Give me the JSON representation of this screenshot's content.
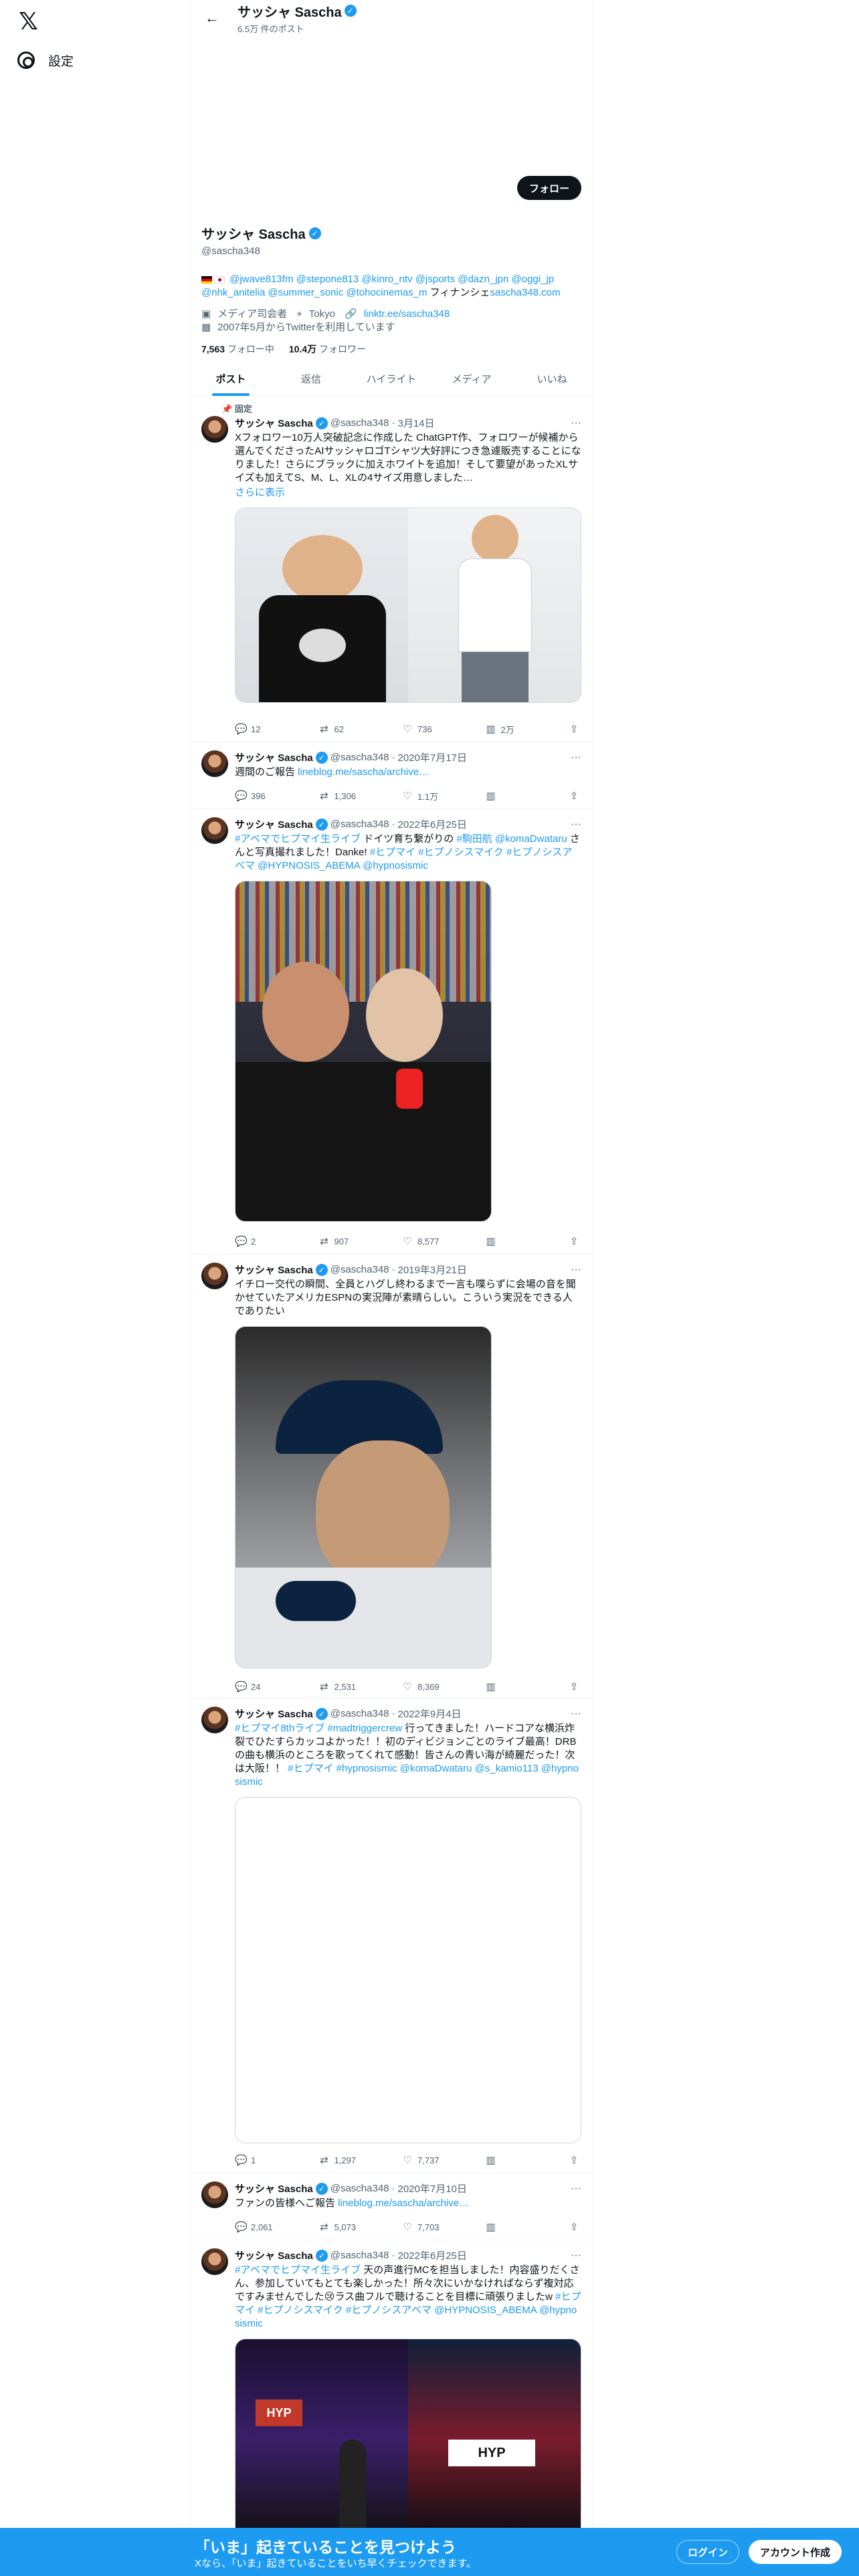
{
  "nav": {
    "logo": "𝕏",
    "settings_label": "設定"
  },
  "topbar": {
    "name": "サッシャ Sascha",
    "post_count": "6.5万 件のポスト"
  },
  "profile": {
    "follow_label": "フォロー",
    "name": "サッシャ Sascha",
    "handle": "@sascha348",
    "bio_links": "@jwave813fm @stepone813 @kinro_ntv @jsports @dazn_jpn @oggi_jp @nhk_anitelia @summer_sonic @tohocinemas_m",
    "bio_suffix": " フィナンシェ",
    "bio_site": "sascha348.com",
    "category": "メディア司会者",
    "location": "Tokyo",
    "link": "linktr.ee/sascha348",
    "joined": "2007年5月からTwitterを利用しています",
    "following_count": "7,563",
    "following_label": "フォロー中",
    "followers_count": "10.4万",
    "followers_label": "フォロワー"
  },
  "tabs": [
    "ポスト",
    "返信",
    "ハイライト",
    "メディア",
    "いいね"
  ],
  "pinned_label": "固定",
  "tweets": [
    {
      "name": "サッシャ Sascha",
      "handle": "@sascha348",
      "date": "3月14日",
      "text": "Xフォロワー10万人突破記念に作成した ChatGPT作、フォロワーが候補から選んでくださったAIサッシャロゴTシャツ大好評につき急遽販売することになりました！さらにブラックに加えホワイトを追加！そして要望があったXLサイズも加えてS、M、L、XLの4サイズ用意しました…",
      "more": "さらに表示",
      "replies": "12",
      "retweets": "62",
      "likes": "736",
      "views": "2万"
    },
    {
      "name": "サッシャ Sascha",
      "handle": "@sascha348",
      "date": "2020年7月17日",
      "text": "週間のご報告 ",
      "link": "lineblog.me/sascha/archive…",
      "replies": "396",
      "retweets": "1,306",
      "likes": "1.1万"
    },
    {
      "name": "サッシャ Sascha",
      "handle": "@sascha348",
      "date": "2022年6月25日",
      "text_a": "#アベマでヒプマイ生ライブ",
      "text_b": " ドイツ育ち繋がりの ",
      "text_c": "#駒田航 @komaDwataru",
      "text_d": " さんと写真撮れました！Danke! ",
      "text_e": "#ヒプマイ #ヒプノシスマイク #ヒプノシスアベマ @HYPNOSIS_ABEMA @hypnosismic",
      "replies": "2",
      "retweets": "907",
      "likes": "8,577"
    },
    {
      "name": "サッシャ Sascha",
      "handle": "@sascha348",
      "date": "2019年3月21日",
      "text": "イチロー交代の瞬間、全員とハグし終わるまで一言も喋らずに会場の音を聞かせていたアメリカESPNの実況陣が素晴らしい。こういう実況をできる人でありたい",
      "replies": "24",
      "retweets": "2,531",
      "likes": "8,369"
    },
    {
      "name": "サッシャ Sascha",
      "handle": "@sascha348",
      "date": "2022年9月4日",
      "text_a": "#ヒプマイ8thライブ #madtriggercrew",
      "text_b": " 行ってきました！ハードコアな横浜炸裂でひたすらカッコよかった！！初のディビジョンごとのライブ最高！DRBの曲も横浜のところを歌ってくれて感動！皆さんの青い海が綺麗だった！次は大阪！！ ",
      "text_c": "#ヒプマイ #hypnosismic @komaDwataru @s_kamio113 @hypnosismic",
      "replies": "1",
      "retweets": "1,297",
      "likes": "7,737"
    },
    {
      "name": "サッシャ Sascha",
      "handle": "@sascha348",
      "date": "2020年7月10日",
      "text": "ファンの皆様へご報告 ",
      "link": "lineblog.me/sascha/archive…",
      "replies": "2,061",
      "retweets": "5,073",
      "likes": "7,703"
    },
    {
      "name": "サッシャ Sascha",
      "handle": "@sascha348",
      "date": "2022年6月25日",
      "text_a": "#アベマでヒプマイ生ライブ",
      "text_b": " 天の声進行MCを担当しました！内容盛りだくさん、参加していてもとても楽しかった！所々次にいかなければならず複対応ですみませんでした😢ラス曲フルで聴けることを目標に頑張りましたw ",
      "text_c": "#ヒプマイ #ヒプノシスマイク #ヒプノシスアベマ @HYPNOSIS_ABEMA @hypnosismic"
    }
  ],
  "bottom": {
    "title": "「いま」起きていることを見つけよう",
    "subtitle": "Xなら、「いま」起きていることをいち早くチェックできます。",
    "login": "ログイン",
    "signup": "アカウント作成"
  }
}
